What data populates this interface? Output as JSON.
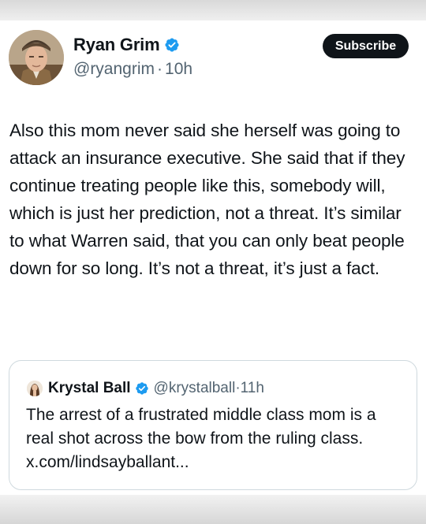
{
  "post": {
    "author_name": "Ryan Grim",
    "author_handle": "@ryangrim",
    "separator": "·",
    "time": "10h",
    "subscribe_label": "Subscribe",
    "text": "Also this mom never said she herself was going to attack an insurance executive. She said that if they continue treating people like this, somebody will, which is just her prediction, not a threat. It’s similar to what Warren said, that you can only beat people down for so long. It’s not a threat, it’s just a fact."
  },
  "quote": {
    "author_name": "Krystal Ball",
    "author_handle": "@krystalball",
    "separator": "·",
    "time": "11h",
    "text": "The arrest of a frustrated middle class mom is a real shot across the bow from the ruling class. x.com/lindsayballant..."
  },
  "colors": {
    "text": "#0f1419",
    "secondary": "#536471",
    "verified": "#1d9bf0",
    "subscribe_bg": "#0f1419",
    "border": "#cfd9de"
  },
  "icons": {
    "verified": "verified-badge-icon"
  }
}
